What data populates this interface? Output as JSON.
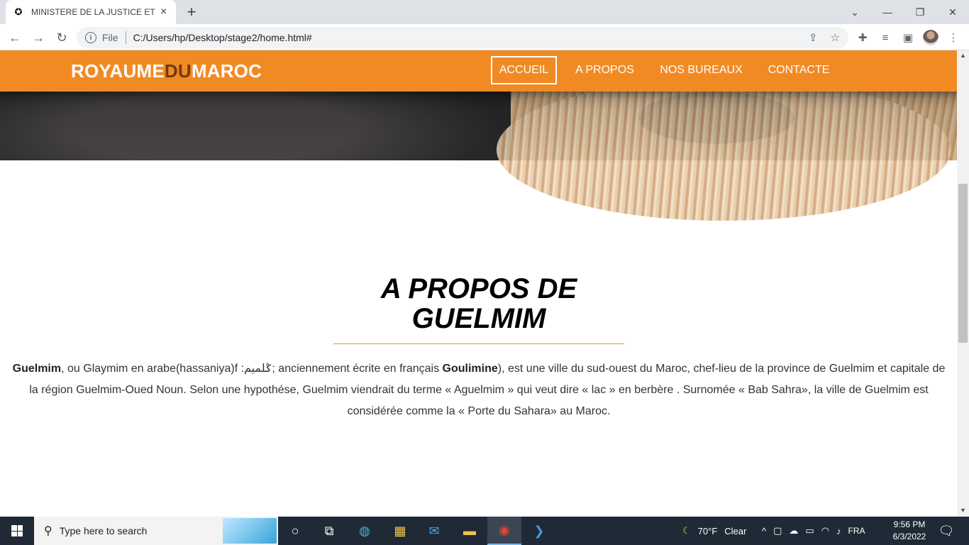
{
  "browser": {
    "tab_title": "MINISTERE DE LA JUSTICE ET DES",
    "url_scheme": "File",
    "url": "C:/Users/hp/Desktop/stage2/home.html#"
  },
  "site": {
    "brand_part1": "ROYAUME",
    "brand_part2": "DU",
    "brand_part3": "MAROC",
    "nav": [
      {
        "label": "ACCUEIL",
        "active": true
      },
      {
        "label": "A PROPOS",
        "active": false
      },
      {
        "label": "NOS BUREAUX",
        "active": false
      },
      {
        "label": "CONTACTE",
        "active": false
      }
    ],
    "about": {
      "title": "A PROPOS DE GUELMIM",
      "p_bold1": "Guelmim",
      "p_text1": ", ou Glaymim en arabe(hassaniya)f :ݣلميم; anciennement écrite en français ",
      "p_bold2": "Goulimine",
      "p_text2": "), est une ville du sud-ouest du Maroc, chef-lieu de la province de Guelmim et capitale de la région Guelmim-Oued Noun. Selon une hypothése, Guelmim viendrait du terme « Aguelmim » qui veut dire « lac » en berbère . Surnomée « Bab Sahra», la ville de Guelmim est considérée comme la « Porte du Sahara» au Maroc."
    }
  },
  "taskbar": {
    "search_placeholder": "Type here to search",
    "weather_temp": "70°F",
    "weather_desc": "Clear",
    "language": "FRA",
    "time": "9:56 PM",
    "date": "6/3/2022"
  }
}
